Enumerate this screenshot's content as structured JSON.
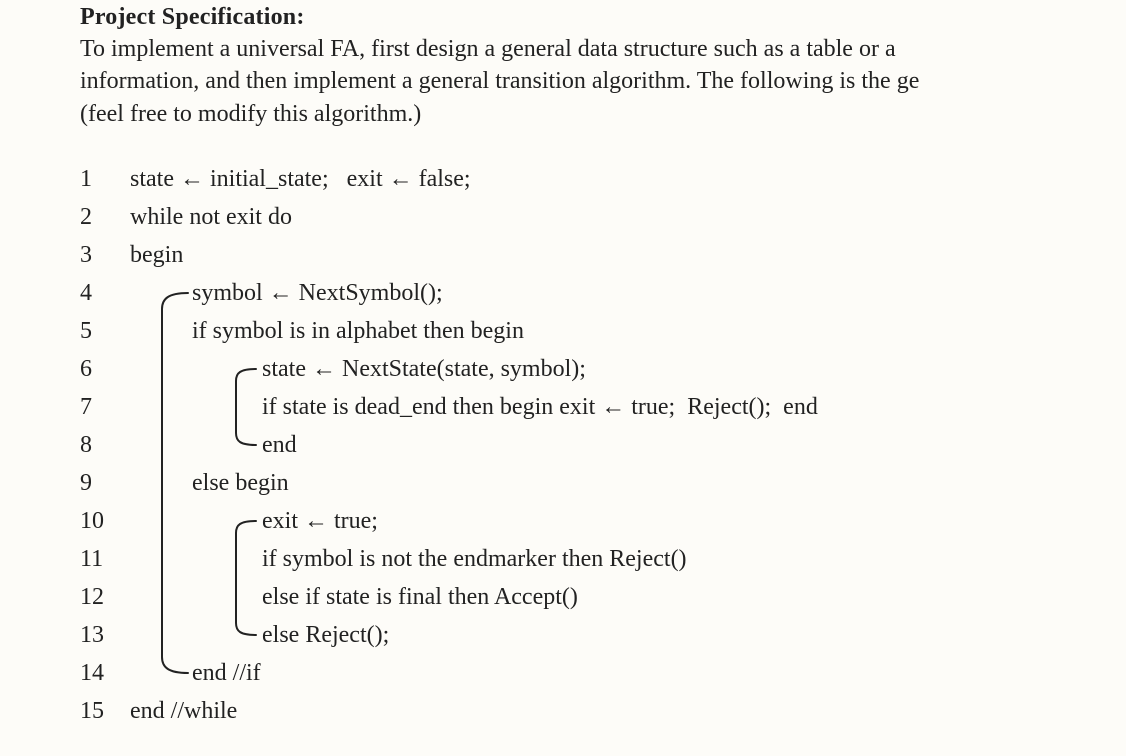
{
  "heading": "Project Specification:",
  "paragraph": "To implement a universal FA, first design a general data structure such as a table or a\ninformation, and then implement a general transition algorithm. The following is the ge\n(feel free to modify this algorithm.)",
  "algorithm": {
    "lines": [
      {
        "n": "1",
        "indent": 0,
        "text": "state ← initial_state;   exit ← false;"
      },
      {
        "n": "2",
        "indent": 0,
        "text": "while not exit do"
      },
      {
        "n": "3",
        "indent": 0,
        "text": "begin"
      },
      {
        "n": "4",
        "indent": 1,
        "text": "symbol ← NextSymbol();"
      },
      {
        "n": "5",
        "indent": 1,
        "text": "if symbol is in alphabet then begin"
      },
      {
        "n": "6",
        "indent": 2,
        "text": "state ← NextState(state, symbol);"
      },
      {
        "n": "7",
        "indent": 2,
        "text": "if state is dead_end then begin exit ← true;  Reject();  end"
      },
      {
        "n": "8",
        "indent": 2,
        "text": "end"
      },
      {
        "n": "9",
        "indent": 1,
        "text": "else begin"
      },
      {
        "n": "10",
        "indent": 2,
        "text": "exit ← true;"
      },
      {
        "n": "11",
        "indent": 2,
        "text": "if symbol is not the endmarker then Reject()"
      },
      {
        "n": "12",
        "indent": 2,
        "text": "else if state is final then Accept()"
      },
      {
        "n": "13",
        "indent": 2,
        "text": "else Reject();"
      },
      {
        "n": "14",
        "indent": 1,
        "text": "end //if"
      },
      {
        "n": "15",
        "indent": 0,
        "text": "end //while"
      }
    ]
  }
}
